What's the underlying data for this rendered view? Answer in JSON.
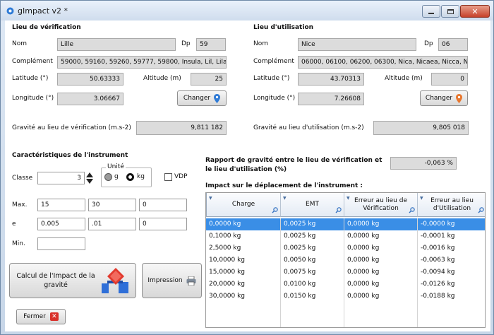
{
  "window": {
    "title": "gImpact v2 *"
  },
  "verif": {
    "header": "Lieu de vérification",
    "nom_label": "Nom",
    "nom": "Lille",
    "dp_label": "Dp",
    "dp": "59",
    "complement_label": "Complément",
    "complement": "59000, 59160, 59260, 59777, 59800, Insula, Lil, Lila, Li",
    "lat_label": "Latitude (°)",
    "lat": "50.63333",
    "alt_label": "Altitude (m)",
    "alt": "25",
    "lon_label": "Longitude (°)",
    "lon": "3.06667",
    "changer": "Changer",
    "gravity_label": "Gravité au lieu de vérification (m.s-2)",
    "gravity": "9,811 182"
  },
  "util": {
    "header": "Lieu d'utilisation",
    "nom_label": "Nom",
    "nom": "Nice",
    "dp_label": "Dp",
    "dp": "06",
    "complement_label": "Complément",
    "complement": "06000, 06100, 06200, 06300, Nica, Nicaea, Nicca, Nice",
    "lat_label": "Latitude (°)",
    "lat": "43.70313",
    "alt_label": "Altitude (m)",
    "alt": "0",
    "lon_label": "Longitude (°)",
    "lon": "7.26608",
    "changer": "Changer",
    "gravity_label": "Gravité au lieu d'utilisation (m.s-2)",
    "gravity": "9,805 018"
  },
  "instrument": {
    "header": "Caractéristiques de l'instrument",
    "classe_label": "Classe",
    "classe": "3",
    "unite_label": "Unité",
    "unit_g": "g",
    "unit_kg": "kg",
    "vdp": "VDP",
    "max_label": "Max.",
    "max": [
      "15",
      "30",
      "0"
    ],
    "e_label": "e",
    "e": [
      "0.005",
      ".01",
      "0"
    ],
    "min_label": "Min.",
    "min": ""
  },
  "rapport": {
    "label_line1": "Rapport de gravité entre le lieu de vérification et",
    "label_line2": "le lieu d'utilisation (%)",
    "value": "-0,063 %"
  },
  "impact": {
    "header": "Impact sur le déplacement de l'instrument :",
    "columns": [
      "Charge",
      "EMT",
      "Erreur au lieu de Vérification",
      "Erreur au lieu d'Utilisation"
    ],
    "rows": [
      [
        "0,0000 kg",
        "0,0025 kg",
        "0,0000 kg",
        "-0,0000 kg"
      ],
      [
        "0,1000 kg",
        "0,0025 kg",
        "0,0000 kg",
        "-0,0001 kg"
      ],
      [
        "2,5000 kg",
        "0,0025 kg",
        "0,0000 kg",
        "-0,0016 kg"
      ],
      [
        "10,0000 kg",
        "0,0050 kg",
        "0,0000 kg",
        "-0,0063 kg"
      ],
      [
        "15,0000 kg",
        "0,0075 kg",
        "0,0000 kg",
        "-0,0094 kg"
      ],
      [
        "20,0000 kg",
        "0,0100 kg",
        "0,0000 kg",
        "-0,0126 kg"
      ],
      [
        "30,0000 kg",
        "0,0150 kg",
        "0,0000 kg",
        "-0,0188 kg"
      ]
    ]
  },
  "buttons": {
    "calcul": "Calcul de l'Impact de la gravité",
    "impression": "Impression",
    "fermer": "Fermer"
  },
  "colors": {
    "selection": "#3a8ee6",
    "pin_verif": "#2f7bd6",
    "pin_util": "#e8772e",
    "close_red": "#d9302a"
  }
}
